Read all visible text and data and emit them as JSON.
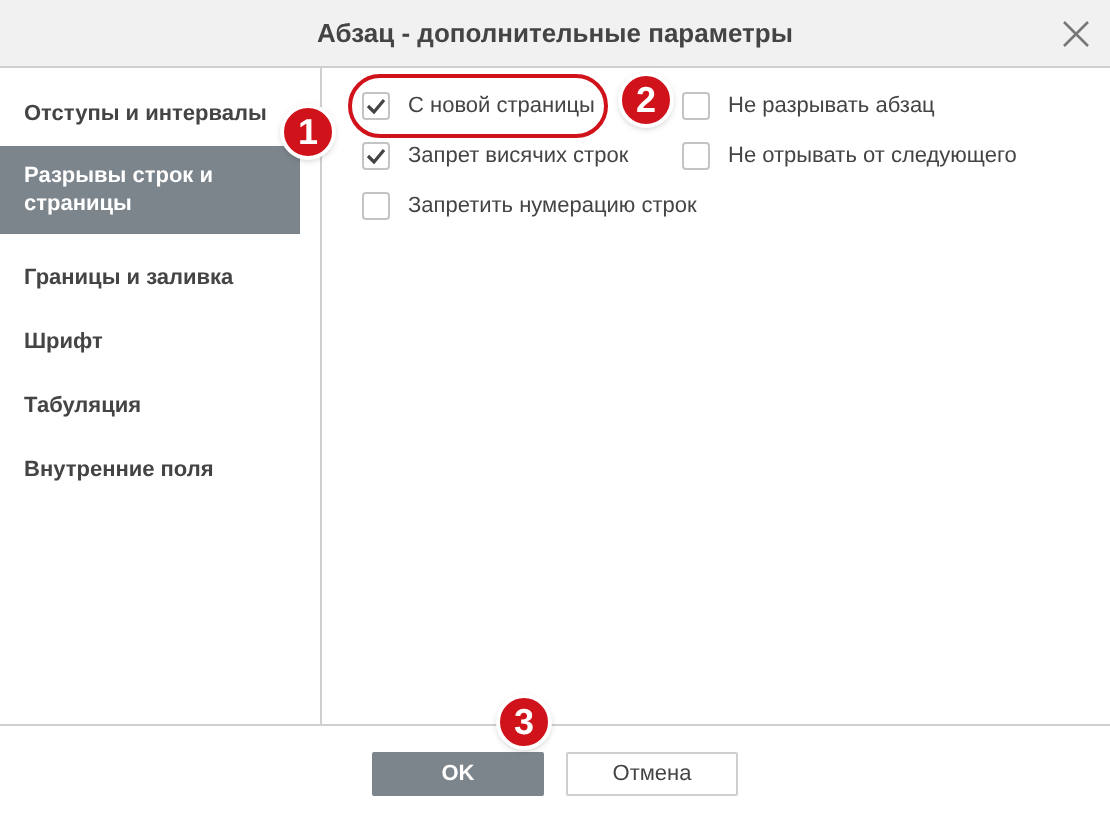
{
  "window": {
    "title": "Абзац - дополнительные параметры"
  },
  "sidebar": {
    "items": [
      {
        "label": "Отступы и интервалы",
        "selected": false
      },
      {
        "label": "Разрывы строк и страницы",
        "selected": true
      },
      {
        "label": "Границы и заливка",
        "selected": false
      },
      {
        "label": "Шрифт",
        "selected": false
      },
      {
        "label": "Табуляция",
        "selected": false
      },
      {
        "label": "Внутренние поля",
        "selected": false
      }
    ]
  },
  "options": [
    {
      "label": "С новой страницы",
      "checked": true,
      "highlighted": true
    },
    {
      "label": "Не разрывать абзац",
      "checked": false,
      "highlighted": false
    },
    {
      "label": "Запрет висячих строк",
      "checked": true,
      "highlighted": false
    },
    {
      "label": "Не отрывать от следующего",
      "checked": false,
      "highlighted": false
    },
    {
      "label": "Запретить нумерацию строк",
      "checked": false,
      "highlighted": false
    }
  ],
  "buttons": [
    {
      "label": "OK",
      "kind": "primary"
    },
    {
      "label": "Отмена",
      "kind": "secondary"
    }
  ],
  "markers": [
    {
      "label": "1"
    },
    {
      "label": "2"
    },
    {
      "label": "3"
    }
  ]
}
